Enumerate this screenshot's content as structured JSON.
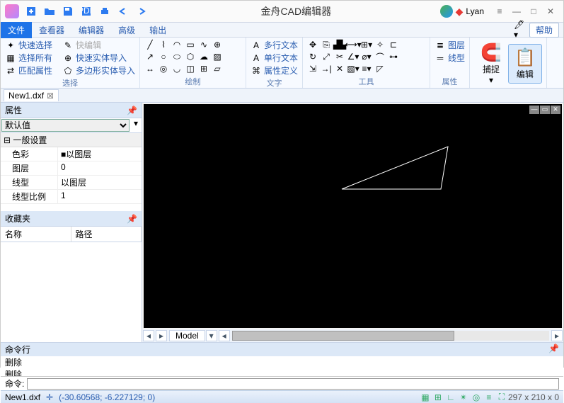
{
  "titlebar": {
    "app_title": "金舟CAD编辑器",
    "username": "Lyan"
  },
  "menu": {
    "tabs": [
      "文件",
      "查看器",
      "编辑器",
      "高级",
      "输出"
    ],
    "help": "帮助"
  },
  "ribbon": {
    "select": {
      "quick": "快速选择",
      "quickedit": "快编辑",
      "selall": "选择所有",
      "import_entity": "快速实体导入",
      "match": "匹配属性",
      "poly_import": "多边形实体导入",
      "label": "选择"
    },
    "draw": {
      "label": "绘制"
    },
    "text": {
      "multi": "多行文本",
      "single": "单行文本",
      "attr": "属性定义",
      "label": "文字"
    },
    "tool": {
      "label": "工具"
    },
    "prop": {
      "layer": "图层",
      "linetype": "线型",
      "label": "属性"
    },
    "snap": "捕捉",
    "edit": "编辑"
  },
  "file_tab": {
    "name": "New1.dxf"
  },
  "prop_panel": {
    "title": "属性",
    "default": "默认值",
    "general": "一般设置",
    "rows": [
      {
        "k": "色彩",
        "v": "■以图层"
      },
      {
        "k": "图层",
        "v": "0"
      },
      {
        "k": "线型",
        "v": "以图层"
      },
      {
        "k": "线型比例",
        "v": "1"
      }
    ]
  },
  "fav": {
    "title": "收藏夹",
    "col1": "名称",
    "col2": "路径"
  },
  "model_tab": "Model",
  "cmd": {
    "title": "命令行",
    "log": [
      "删除",
      "删除"
    ],
    "prompt": "命令:"
  },
  "status": {
    "file": "New1.dxf",
    "coords": "(-30.60568; -6.227129; 0)",
    "dims": "297 x 210 x 0"
  }
}
